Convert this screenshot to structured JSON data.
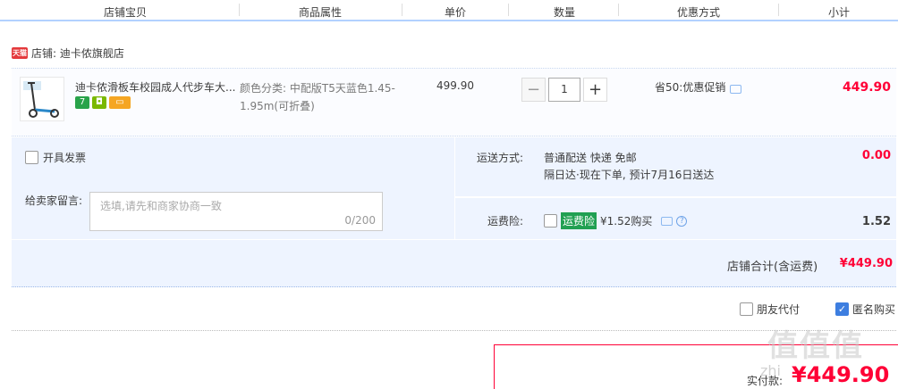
{
  "header": {
    "col_shop_item": "店铺宝贝",
    "col_attrs": "商品属性",
    "col_price": "单价",
    "col_qty": "数量",
    "col_promo": "优惠方式",
    "col_subtotal": "小计"
  },
  "shop": {
    "icon_text": "天猫",
    "label": "店铺: 迪卡侬旗舰店"
  },
  "item": {
    "title": "迪卡侬滑板车校园成人代步车大...",
    "attr_line1": "颜色分类: 中配版T5天蓝色1.45-",
    "attr_line2": "1.95m(可折叠)",
    "price": "499.90",
    "quantity": "1",
    "qty_minus": "−",
    "qty_plus": "+",
    "promo": "省50:优惠促销",
    "subtotal": "449.90",
    "badges": [
      "7",
      "",
      ""
    ]
  },
  "invoice": {
    "label": "开具发票",
    "checked": false
  },
  "message": {
    "label": "给卖家留言:",
    "placeholder": "选填,请先和商家协商一致",
    "count": "0/200"
  },
  "shipping": {
    "label": "运送方式:",
    "method": "普通配送 快递 免邮",
    "eta": "隔日达·现在下单, 预计7月16日送达",
    "fee": "0.00"
  },
  "insurance": {
    "label": "运费险:",
    "tag": "运费险",
    "price_text": "¥1.52购买",
    "fee": "1.52"
  },
  "shop_total": {
    "label": "店铺合计(含运费)",
    "value": "¥449.90"
  },
  "options": {
    "friend_pay": "朋友代付",
    "anonymous": "匿名购买",
    "anonymous_checked": true
  },
  "payment": {
    "label": "实付款:",
    "value": "¥449.90"
  },
  "watermark": {
    "text": "值值值",
    "sub": "zhi"
  },
  "colors": {
    "accent_red": "#ff0036",
    "panel_blue": "#eef4ff",
    "check_blue": "#3d7ee0",
    "insurance_green": "#21a052"
  }
}
